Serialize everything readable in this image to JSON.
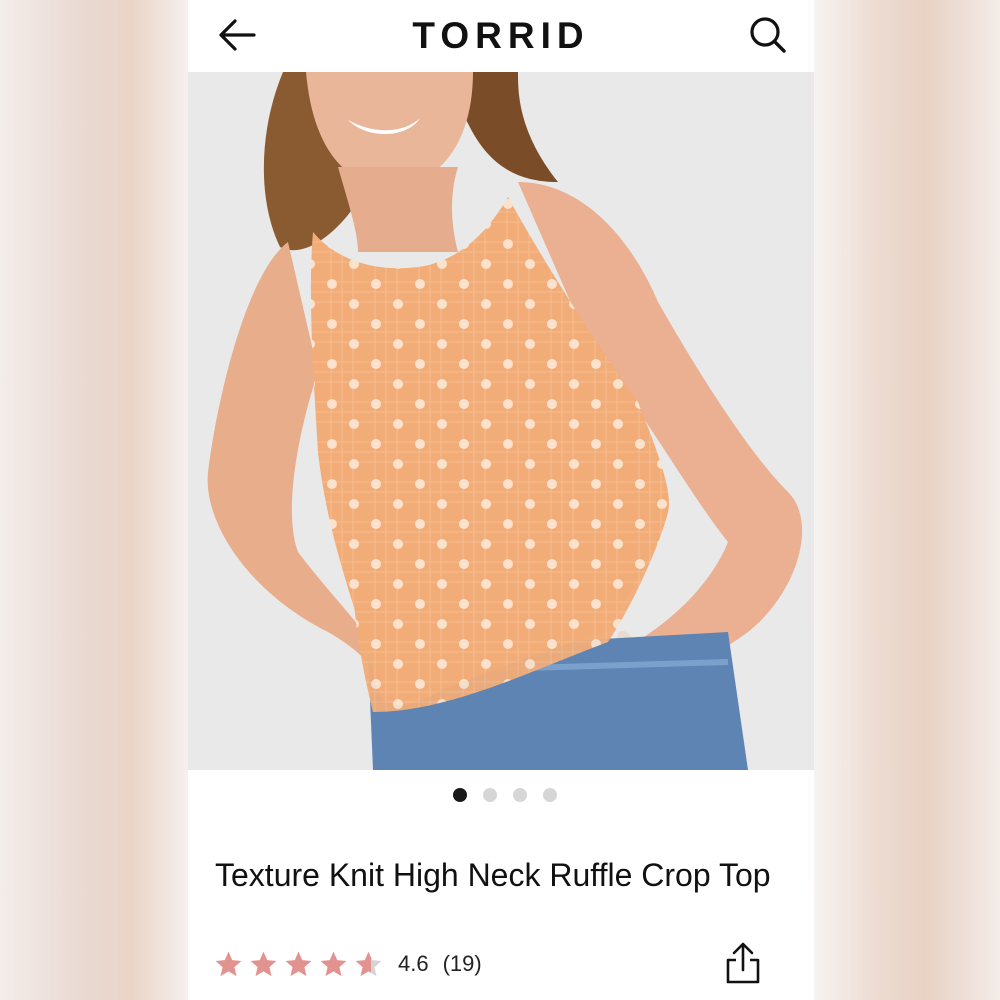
{
  "header": {
    "brand": "TORRID",
    "back_icon": "arrow-left-icon",
    "search_icon": "search-icon"
  },
  "gallery": {
    "image_description": "model wearing peach ruffle crop top",
    "pages": 4,
    "active_index": 0
  },
  "product": {
    "title": "Texture Knit High Neck Ruffle Crop Top",
    "rating": "4.6",
    "review_count": "(19)",
    "rating_value": 4.6,
    "star_color": "#e3938f",
    "share_icon": "share-icon"
  }
}
